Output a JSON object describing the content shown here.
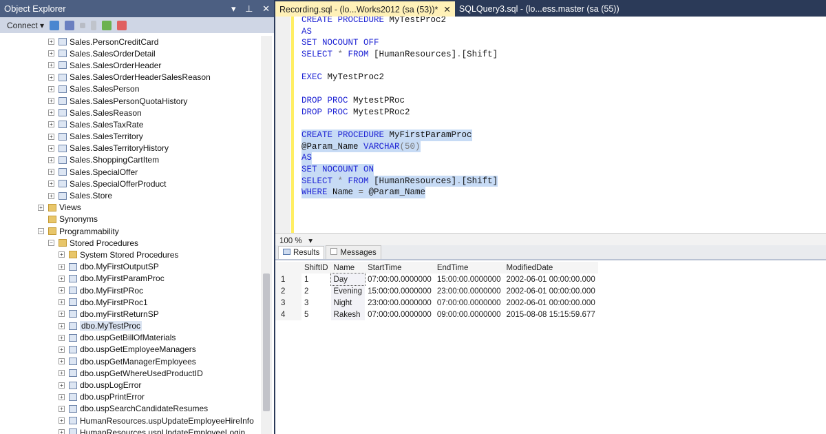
{
  "object_explorer": {
    "title": "Object Explorer",
    "controls": [
      "▾",
      "⊥",
      "✕"
    ],
    "connect_label": "Connect ▾",
    "tree": [
      {
        "label": "Sales.PersonCreditCard",
        "level": 2,
        "icon": "table-icon"
      },
      {
        "label": "Sales.SalesOrderDetail",
        "level": 2,
        "icon": "table-icon"
      },
      {
        "label": "Sales.SalesOrderHeader",
        "level": 2,
        "icon": "table-icon"
      },
      {
        "label": "Sales.SalesOrderHeaderSalesReason",
        "level": 2,
        "icon": "table-icon"
      },
      {
        "label": "Sales.SalesPerson",
        "level": 2,
        "icon": "table-icon"
      },
      {
        "label": "Sales.SalesPersonQuotaHistory",
        "level": 2,
        "icon": "table-icon"
      },
      {
        "label": "Sales.SalesReason",
        "level": 2,
        "icon": "table-icon"
      },
      {
        "label": "Sales.SalesTaxRate",
        "level": 2,
        "icon": "table-icon"
      },
      {
        "label": "Sales.SalesTerritory",
        "level": 2,
        "icon": "table-icon"
      },
      {
        "label": "Sales.SalesTerritoryHistory",
        "level": 2,
        "icon": "table-icon"
      },
      {
        "label": "Sales.ShoppingCartItem",
        "level": 2,
        "icon": "table-icon"
      },
      {
        "label": "Sales.SpecialOffer",
        "level": 2,
        "icon": "table-icon"
      },
      {
        "label": "Sales.SpecialOfferProduct",
        "level": 2,
        "icon": "table-icon"
      },
      {
        "label": "Sales.Store",
        "level": 2,
        "icon": "table-icon"
      },
      {
        "label": "Views",
        "level": 1,
        "icon": "folder-icon"
      },
      {
        "label": "Synonyms",
        "level": 1,
        "icon": "folder-icon",
        "noexp": true
      },
      {
        "label": "Programmability",
        "level": 1,
        "icon": "folder-icon",
        "open": true
      },
      {
        "label": "Stored Procedures",
        "level": 2,
        "icon": "folder-icon",
        "open": true
      },
      {
        "label": "System Stored Procedures",
        "level": 3,
        "icon": "folder-icon"
      },
      {
        "label": "dbo.MyFirstOutputSP",
        "level": 3,
        "icon": "procedure-icon"
      },
      {
        "label": "dbo.MyFirstParamProc",
        "level": 3,
        "icon": "procedure-icon"
      },
      {
        "label": "dbo.MyFirstPRoc",
        "level": 3,
        "icon": "procedure-icon"
      },
      {
        "label": "dbo.MyFirstPRoc1",
        "level": 3,
        "icon": "procedure-icon"
      },
      {
        "label": "dbo.myFirstReturnSP",
        "level": 3,
        "icon": "procedure-icon"
      },
      {
        "label": "dbo.MyTestProc",
        "level": 3,
        "icon": "procedure-icon",
        "selected": true
      },
      {
        "label": "dbo.uspGetBillOfMaterials",
        "level": 3,
        "icon": "procedure-icon"
      },
      {
        "label": "dbo.uspGetEmployeeManagers",
        "level": 3,
        "icon": "procedure-icon"
      },
      {
        "label": "dbo.uspGetManagerEmployees",
        "level": 3,
        "icon": "procedure-icon"
      },
      {
        "label": "dbo.uspGetWhereUsedProductID",
        "level": 3,
        "icon": "procedure-icon"
      },
      {
        "label": "dbo.uspLogError",
        "level": 3,
        "icon": "procedure-icon"
      },
      {
        "label": "dbo.uspPrintError",
        "level": 3,
        "icon": "procedure-icon"
      },
      {
        "label": "dbo.uspSearchCandidateResumes",
        "level": 3,
        "icon": "procedure-icon"
      },
      {
        "label": "HumanResources.uspUpdateEmployeeHireInfo",
        "level": 3,
        "icon": "procedure-icon"
      },
      {
        "label": "HumanResources.uspUpdateEmployeeLogin",
        "level": 3,
        "icon": "procedure-icon"
      }
    ]
  },
  "tabs": [
    {
      "label": "Recording.sql - (lo...Works2012 (sa (53))*",
      "active": true,
      "close": "✕"
    },
    {
      "label": "SQLQuery3.sql - (lo...ess.master (sa (55))"
    }
  ],
  "editor": {
    "lines": [
      {
        "tokens": [
          [
            "kw",
            "CREATE PROCEDURE "
          ],
          [
            "fn",
            "MyTestProc2"
          ]
        ]
      },
      {
        "tokens": [
          [
            "kw",
            "AS"
          ]
        ]
      },
      {
        "tokens": [
          [
            "kw",
            "SET NOCOUNT OFF"
          ]
        ]
      },
      {
        "tokens": [
          [
            "kw",
            "SELECT "
          ],
          [
            "gr",
            "* "
          ],
          [
            "kw",
            "FROM "
          ],
          [
            "fn",
            "[HumanResources]"
          ],
          [
            "gr",
            "."
          ],
          [
            "fn",
            "[Shift]"
          ]
        ]
      },
      {
        "tokens": []
      },
      {
        "tokens": [
          [
            "kw",
            "EXEC "
          ],
          [
            "fn",
            "MyTestProc2"
          ]
        ]
      },
      {
        "tokens": []
      },
      {
        "tokens": [
          [
            "kw",
            "DROP PROC "
          ],
          [
            "fn",
            "MytestPRoc"
          ]
        ]
      },
      {
        "tokens": [
          [
            "kw",
            "DROP PROC "
          ],
          [
            "fn",
            "MytestPRoc2"
          ]
        ]
      },
      {
        "tokens": []
      },
      {
        "tokens": [
          [
            "kw",
            "CREATE PROCEDURE "
          ],
          [
            "fn",
            "MyFirstParamProc"
          ]
        ],
        "selected": true
      },
      {
        "tokens": [
          [
            "fn",
            "@Param_Name "
          ],
          [
            "kw",
            "VARCHAR"
          ],
          [
            "gr",
            "(50)"
          ]
        ],
        "selected": true
      },
      {
        "tokens": [
          [
            "kw",
            "AS"
          ]
        ],
        "selected": true
      },
      {
        "tokens": [
          [
            "kw",
            "SET NOCOUNT ON"
          ]
        ],
        "selected": true
      },
      {
        "tokens": [
          [
            "kw",
            "SELECT "
          ],
          [
            "gr",
            "* "
          ],
          [
            "kw",
            "FROM "
          ],
          [
            "fn",
            "[HumanResources]"
          ],
          [
            "gr",
            "."
          ],
          [
            "fn",
            "[Shift]"
          ]
        ],
        "selected": true
      },
      {
        "tokens": [
          [
            "kw",
            "WHERE "
          ],
          [
            "fn",
            "Name "
          ],
          [
            "gr",
            "= "
          ],
          [
            "fn",
            "@Param_Name"
          ]
        ],
        "selected": true
      }
    ]
  },
  "zoom": "100 %",
  "result_tabs": [
    "Results",
    "Messages"
  ],
  "results": {
    "columns": [
      "ShiftID",
      "Name",
      "StartTime",
      "EndTime",
      "ModifiedDate"
    ],
    "rows": [
      [
        "1",
        "1",
        "Day",
        "07:00:00.0000000",
        "15:00:00.0000000",
        "2002-06-01 00:00:00.000"
      ],
      [
        "2",
        "2",
        "Evening",
        "15:00:00.0000000",
        "23:00:00.0000000",
        "2002-06-01 00:00:00.000"
      ],
      [
        "3",
        "3",
        "Night",
        "23:00:00.0000000",
        "07:00:00.0000000",
        "2002-06-01 00:00:00.000"
      ],
      [
        "4",
        "5",
        "Rakesh",
        "07:00:00.0000000",
        "09:00:00.0000000",
        "2015-08-08 15:15:59.677"
      ]
    ]
  }
}
